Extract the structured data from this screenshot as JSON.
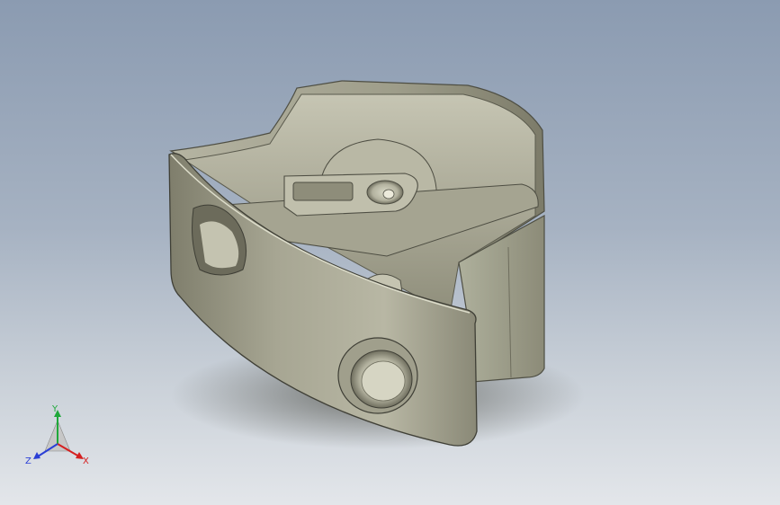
{
  "viewport": {
    "background_top": "#8b9bb1",
    "background_bottom": "#e3e6ea",
    "part_color": "#a9a995",
    "part_shadow_color": "#5a5a4d"
  },
  "triad": {
    "x_label": "X",
    "y_label": "Y",
    "z_label": "Z",
    "x_color": "#d52020",
    "y_color": "#1fa83a",
    "z_color": "#2a3fd6"
  }
}
